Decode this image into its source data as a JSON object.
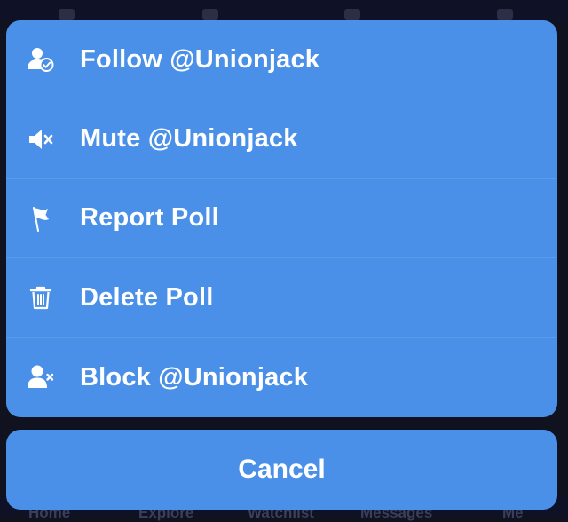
{
  "action_sheet": {
    "items": [
      {
        "label": "Follow @Unionjack",
        "icon": "follow-user-icon"
      },
      {
        "label": "Mute @Unionjack",
        "icon": "mute-speaker-icon"
      },
      {
        "label": "Report Poll",
        "icon": "flag-icon"
      },
      {
        "label": "Delete Poll",
        "icon": "trash-icon"
      },
      {
        "label": "Block @Unionjack",
        "icon": "block-user-icon"
      }
    ],
    "cancel_label": "Cancel"
  },
  "background_tabs": [
    "Home",
    "Explore",
    "Watchlist",
    "Messages",
    "Me"
  ],
  "colors": {
    "sheet": "#4a90e8",
    "backdrop": "#10121f",
    "text": "#ffffff"
  }
}
